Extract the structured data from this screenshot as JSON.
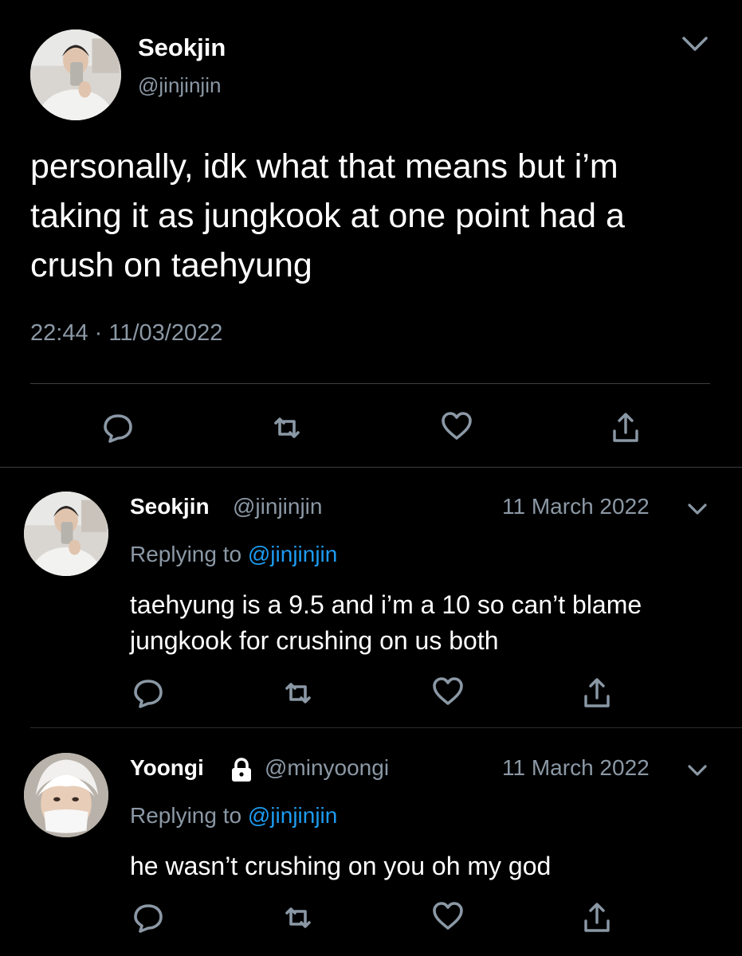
{
  "main_tweet": {
    "author_name": "Seokjin",
    "author_handle": "@jinjinjin",
    "text": "personally, idk what that means but i’m taking it as jungkook at one point had a crush on taehyung",
    "time": "22:44",
    "separator": "·",
    "date": "11/03/2022",
    "actions": [
      "reply-icon",
      "retweet-icon",
      "like-icon",
      "share-icon"
    ]
  },
  "replies": [
    {
      "author_name": "Seokjin",
      "author_handle": "@jinjinjin",
      "date": "11 March 2022",
      "replying_prefix": "Replying to",
      "replying_to": "@jinjinjin",
      "text": "taehyung is a 9.5 and i’m a 10 so can’t blame jungkook for crushing on us both"
    },
    {
      "author_name": "Yoongi",
      "author_handle": "@minyoongi",
      "locked": true,
      "date": "11 March 2022",
      "replying_prefix": "Replying to",
      "replying_to": "@jinjinjin",
      "text": "he wasn’t crushing on you oh my god"
    }
  ],
  "colors": {
    "background": "#000000",
    "text_primary": "#ffffff",
    "text_secondary": "#8b98a5",
    "link": "#1d9bf0",
    "divider": "#3a3e42"
  }
}
